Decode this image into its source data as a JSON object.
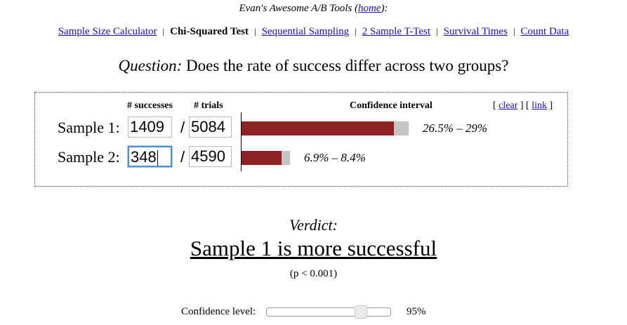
{
  "header": {
    "title_prefix": "Evan's Awesome A/B Tools (",
    "home_link": "home",
    "title_suffix": "):"
  },
  "nav": {
    "items": [
      {
        "label": "Sample Size Calculator",
        "active": false
      },
      {
        "label": "Chi-Squared Test",
        "active": true
      },
      {
        "label": "Sequential Sampling",
        "active": false
      },
      {
        "label": "2 Sample T-Test",
        "active": false
      },
      {
        "label": "Survival Times",
        "active": false
      },
      {
        "label": "Count Data",
        "active": false
      }
    ],
    "separator": "|"
  },
  "question": {
    "label": "Question:",
    "text": "Does the rate of success differ across two groups?"
  },
  "panel": {
    "col_successes": "# successes",
    "col_trials": "# trials",
    "col_ci": "Confidence interval",
    "links_open": "[",
    "clear_link": "clear",
    "links_mid": "] [",
    "link_link": "link",
    "links_close": "]",
    "slash": "/",
    "samples": [
      {
        "label": "Sample 1:",
        "successes": "1409",
        "trials": "5084",
        "ci_text": "26.5% – 29%",
        "ci_low": 0.265,
        "ci_high": 0.29
      },
      {
        "label": "Sample 2:",
        "successes": "348",
        "trials": "4590",
        "ci_text": "6.9% – 8.4%",
        "ci_low": 0.069,
        "ci_high": 0.084
      }
    ]
  },
  "verdict": {
    "label": "Verdict:",
    "text": "Sample 1 is more successful",
    "p_value": "(p < 0.001)"
  },
  "confidence": {
    "label": "Confidence level:",
    "value_text": "95%",
    "value": 95,
    "min": 80,
    "max": 99
  },
  "colors": {
    "bar_fill": "#8b2323",
    "bar_interval": "#c4c4c4",
    "link": "#1a0dab",
    "focus_ring": "#4a90e2"
  }
}
